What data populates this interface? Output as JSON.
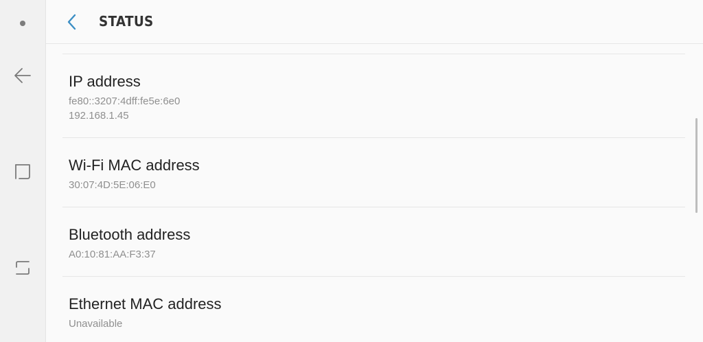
{
  "header": {
    "title": "STATUS"
  },
  "navbar": {
    "icons": [
      "dot-indicator",
      "back-arrow-icon",
      "recent-apps-icon",
      "home-icon"
    ]
  },
  "items": [
    {
      "title": "IP address",
      "lines": [
        "fe80::3207:4dff:fe5e:6e0",
        "192.168.1.45"
      ]
    },
    {
      "title": "Wi-Fi MAC address",
      "lines": [
        "30:07:4D:5E:06:E0"
      ]
    },
    {
      "title": "Bluetooth address",
      "lines": [
        "A0:10:81:AA:F3:37"
      ]
    },
    {
      "title": "Ethernet MAC address",
      "lines": [
        "Unavailable"
      ]
    }
  ],
  "colors": {
    "accent": "#3b8ec4",
    "title_text": "#222222",
    "sub_text": "#8f8f8f",
    "background": "#fafafa",
    "navbar": "#f1f1f1"
  }
}
